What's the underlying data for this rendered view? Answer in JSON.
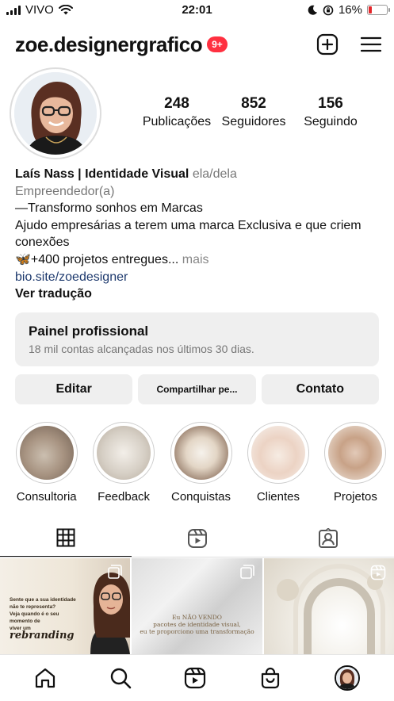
{
  "status_bar": {
    "carrier": "VIVO",
    "time": "22:01",
    "battery_percent": "16%",
    "battery_level": 0.16,
    "battery_color": "#e5262a",
    "icons": [
      "signal-icon",
      "wifi-icon",
      "moon-icon",
      "orientation-lock-icon",
      "battery-icon"
    ]
  },
  "header": {
    "username": "zoe.designergrafico",
    "notification_badge": "9+",
    "badge_color": "#ff3040"
  },
  "profile": {
    "stats": [
      {
        "value": "248",
        "label": "Publicações"
      },
      {
        "value": "852",
        "label": "Seguidores"
      },
      {
        "value": "156",
        "label": "Seguindo"
      }
    ],
    "name": "Laís Nass | Identidade Visual",
    "pronouns": "ela/dela",
    "category": "Empreendedor(a)",
    "bio_lines": [
      "—Transformo sonhos em Marcas",
      "Ajudo empresárias a terem uma marca Exclusiva e que criem conexões",
      "🦋+400 projetos entregues..."
    ],
    "more": "mais",
    "link": "bio.site/zoedesigner",
    "translate": "Ver tradução"
  },
  "professional_panel": {
    "title": "Painel profissional",
    "subtitle": "18 mil contas alcançadas nos últimos 30 dias."
  },
  "buttons": {
    "edit": "Editar",
    "share": "Compartilhar pe...",
    "contact": "Contato"
  },
  "highlights": [
    {
      "label": "Consultoria"
    },
    {
      "label": "Feedback"
    },
    {
      "label": "Conquistas"
    },
    {
      "label": "Clientes"
    },
    {
      "label": "Projetos"
    }
  ],
  "tabs": [
    "grid-icon",
    "reels-icon",
    "tagged-icon"
  ],
  "posts": {
    "post1": {
      "line1": "Sente que a sua identidade",
      "line2": "não te representa?",
      "line3": "Veja quando é o seu momento de",
      "line4": "viver um",
      "big": "rebranding"
    },
    "post2": {
      "line1": "Eu NÃO VENDO",
      "line2": "pacotes de identidade visual,",
      "line3": "eu te proporciono uma transformação"
    }
  },
  "bottom_nav": [
    "home-icon",
    "search-icon",
    "reels-icon",
    "shop-icon",
    "profile-avatar"
  ]
}
